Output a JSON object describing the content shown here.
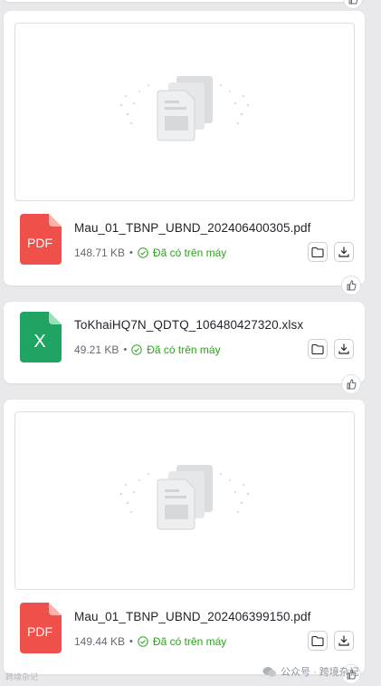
{
  "files": [
    {
      "name": "Mau_01_TBNP_UBND_202406400305.pdf",
      "size": "148.71 KB",
      "type_label": "PDF",
      "status": "Đã có trên máy",
      "icon": "pdf-file-icon"
    },
    {
      "name": "ToKhaiHQ7N_QDTQ_106480427320.xlsx",
      "size": "49.21 KB",
      "type_label": "X",
      "status": "Đã có trên máy",
      "icon": "excel-file-icon"
    },
    {
      "name": "Mau_01_TBNP_UBND_202406399150.pdf",
      "size": "149.44 KB",
      "type_label": "PDF",
      "status": "Đã có trên máy",
      "icon": "pdf-file-icon"
    }
  ],
  "separator": "•",
  "watermark": {
    "right": "公众号 · 跨境杂记",
    "left": "跨境杂记"
  },
  "colors": {
    "pdf": "#f0504a",
    "excel": "#1fa463",
    "status": "#2ea121",
    "background": "#e9e9eb"
  }
}
